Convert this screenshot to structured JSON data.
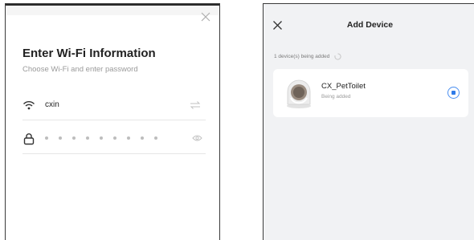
{
  "wifi_screen": {
    "title": "Enter Wi-Fi Information",
    "subtitle": "Choose Wi-Fi and enter password",
    "ssid": "cxin",
    "password_masked_length": 9,
    "icons": {
      "close": "close-icon",
      "wifi": "wifi-icon",
      "switch_network": "switch-network-icon",
      "lock": "lock-icon",
      "show_password": "eye-icon"
    }
  },
  "add_device_screen": {
    "title": "Add Device",
    "status": "1 device(s) being added",
    "devices": [
      {
        "name": "CX_PetToilet",
        "status": "Being added",
        "selected": true
      }
    ],
    "accent_color": "#2f7be8"
  }
}
